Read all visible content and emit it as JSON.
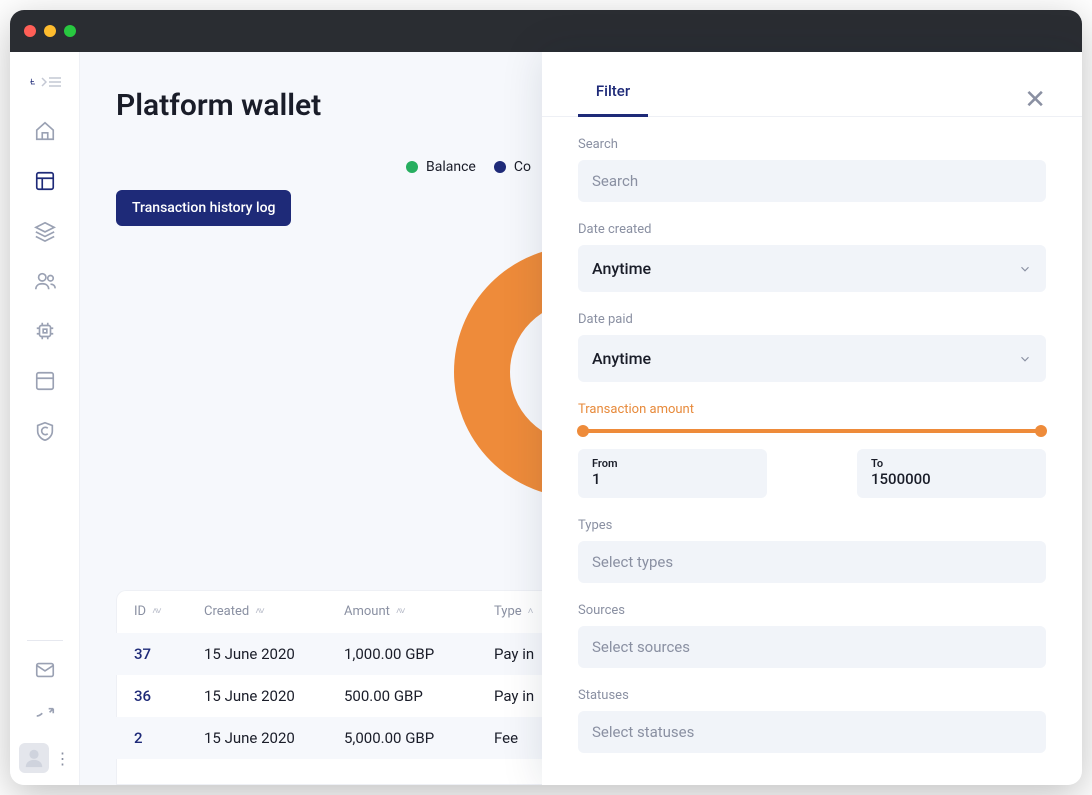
{
  "page": {
    "title": "Platform wallet"
  },
  "legend": {
    "balance": {
      "label": "Balance",
      "color": "#27ae60"
    },
    "compare": {
      "label": "Co",
      "color": "#1e2a78"
    }
  },
  "toolbar": {
    "transaction_history_log": "Transaction history log"
  },
  "table": {
    "columns": {
      "id": "ID",
      "created": "Created",
      "amount": "Amount",
      "type": "Type"
    },
    "rows": [
      {
        "id": "37",
        "created": "15 June 2020",
        "amount": "1,000.00 GBP",
        "type": "Pay in"
      },
      {
        "id": "36",
        "created": "15 June 2020",
        "amount": "500.00 GBP",
        "type": "Pay in"
      },
      {
        "id": "2",
        "created": "15 June 2020",
        "amount": "5,000.00 GBP",
        "type": "Fee"
      }
    ]
  },
  "filter": {
    "tab": "Filter",
    "search_label": "Search",
    "search_placeholder": "Search",
    "date_created": {
      "label": "Date created",
      "value": "Anytime"
    },
    "date_paid": {
      "label": "Date paid",
      "value": "Anytime"
    },
    "amount": {
      "label": "Transaction amount",
      "from_label": "From",
      "from": "1",
      "to_label": "To",
      "to": "1500000"
    },
    "types": {
      "label": "Types",
      "placeholder": "Select types"
    },
    "sources": {
      "label": "Sources",
      "placeholder": "Select sources"
    },
    "statuses": {
      "label": "Statuses",
      "placeholder": "Select statuses"
    }
  },
  "colors": {
    "accent": "#1e2a78",
    "slider": "#ee8b3a",
    "donut": "#ee8b3a"
  }
}
